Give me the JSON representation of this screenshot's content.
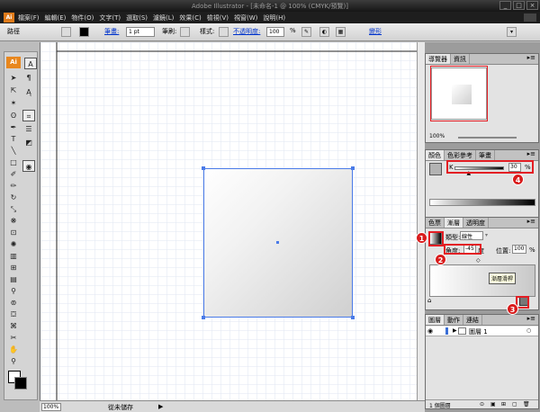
{
  "window": {
    "title": "Adobe Illustrator - [未命名-1 @ 100% (CMYK/預覽)]",
    "buttons": [
      "_",
      "□",
      "×"
    ]
  },
  "menubar": {
    "logo": "Ai",
    "items": [
      "檔案(F)",
      "編輯(E)",
      "物件(O)",
      "文字(T)",
      "選取(S)",
      "濾鏡(L)",
      "效果(C)",
      "檢視(V)",
      "視窗(W)",
      "說明(H)"
    ]
  },
  "controlbar": {
    "selection_label": "路徑",
    "stroke_label": "筆畫:",
    "stroke_value": "1 pt",
    "brush_label": "筆刷:",
    "style_label": "樣式:",
    "opacity_label": "不透明度:",
    "opacity_value": "100",
    "opacity_unit": "%",
    "transform_label": "變形"
  },
  "tools": {
    "ai_badge": "Ai",
    "text_tool": "T"
  },
  "status": {
    "zoom": "100%",
    "status_text": "從未儲存"
  },
  "navigator": {
    "tabs": [
      "導覽器",
      "資訊"
    ],
    "zoom": "100%"
  },
  "color": {
    "tabs": [
      "顏色",
      "色彩參考",
      "筆畫"
    ],
    "channel": "K",
    "value": "30",
    "unit": "%",
    "slider_fraction": 0.3
  },
  "gradient": {
    "tabs": [
      "色票",
      "漸層",
      "透明度"
    ],
    "type_label": "類型:",
    "type_value": "線性",
    "angle_label": "角度:",
    "angle_value": "-45",
    "angle_unit": "度",
    "location_label": "位置:",
    "location_value": "100",
    "location_unit": "%",
    "tooltip": "漸層滑桿"
  },
  "layers": {
    "tabs": [
      "圖層",
      "動作",
      "連結"
    ],
    "layer_name": "圖層 1",
    "count_label": "1 個圖層"
  },
  "callouts": [
    "1",
    "2",
    "3",
    "4"
  ],
  "colors": {
    "accent": "#e31e24",
    "selection": "#4a7be8",
    "ai_orange": "#e8871e"
  }
}
